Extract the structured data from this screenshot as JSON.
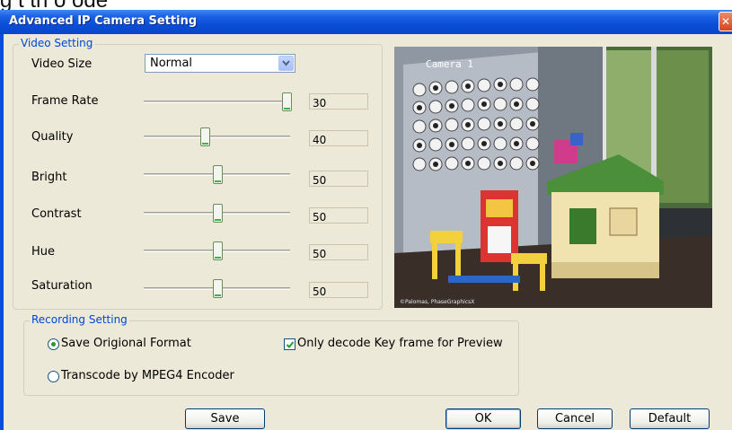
{
  "page_top_fragment": "g t th  o   ode",
  "window": {
    "title": "Advanced IP Camera Setting",
    "close_glyph": "✕"
  },
  "video_setting": {
    "legend": "Video Setting",
    "video_size": {
      "label": "Video Size",
      "value": "Normal"
    },
    "sliders": [
      {
        "id": "frame-rate",
        "label": "Frame Rate",
        "value": "30",
        "level": 1.0
      },
      {
        "id": "quality",
        "label": "Quality",
        "value": "40",
        "level": 0.41
      },
      {
        "id": "bright",
        "label": "Bright",
        "value": "50",
        "level": 0.5
      },
      {
        "id": "contrast",
        "label": "Contrast",
        "value": "50",
        "level": 0.5
      },
      {
        "id": "hue",
        "label": "Hue",
        "value": "50",
        "level": 0.5
      },
      {
        "id": "saturation",
        "label": "Saturation",
        "value": "50",
        "level": 0.5
      }
    ]
  },
  "preview": {
    "caption": "Camera 1",
    "credit": "©Palomas, PhaseGraphicsX"
  },
  "recording_setting": {
    "legend": "Recording Setting",
    "save_original": {
      "label": "Save Origional Format",
      "checked": true
    },
    "transcode": {
      "label": "Transcode by MPEG4 Encoder",
      "checked": false
    },
    "decode_key_frame": {
      "label": "Only decode Key frame for Preview",
      "checked": true
    }
  },
  "buttons": {
    "save": "Save",
    "ok": "OK",
    "cancel": "Cancel",
    "default": "Default"
  },
  "colors": {
    "titlebar": "#0a4fd8",
    "dialog_bg": "#ece9d8",
    "group_label": "#0046d5",
    "thumb_accent": "#39b54a"
  }
}
